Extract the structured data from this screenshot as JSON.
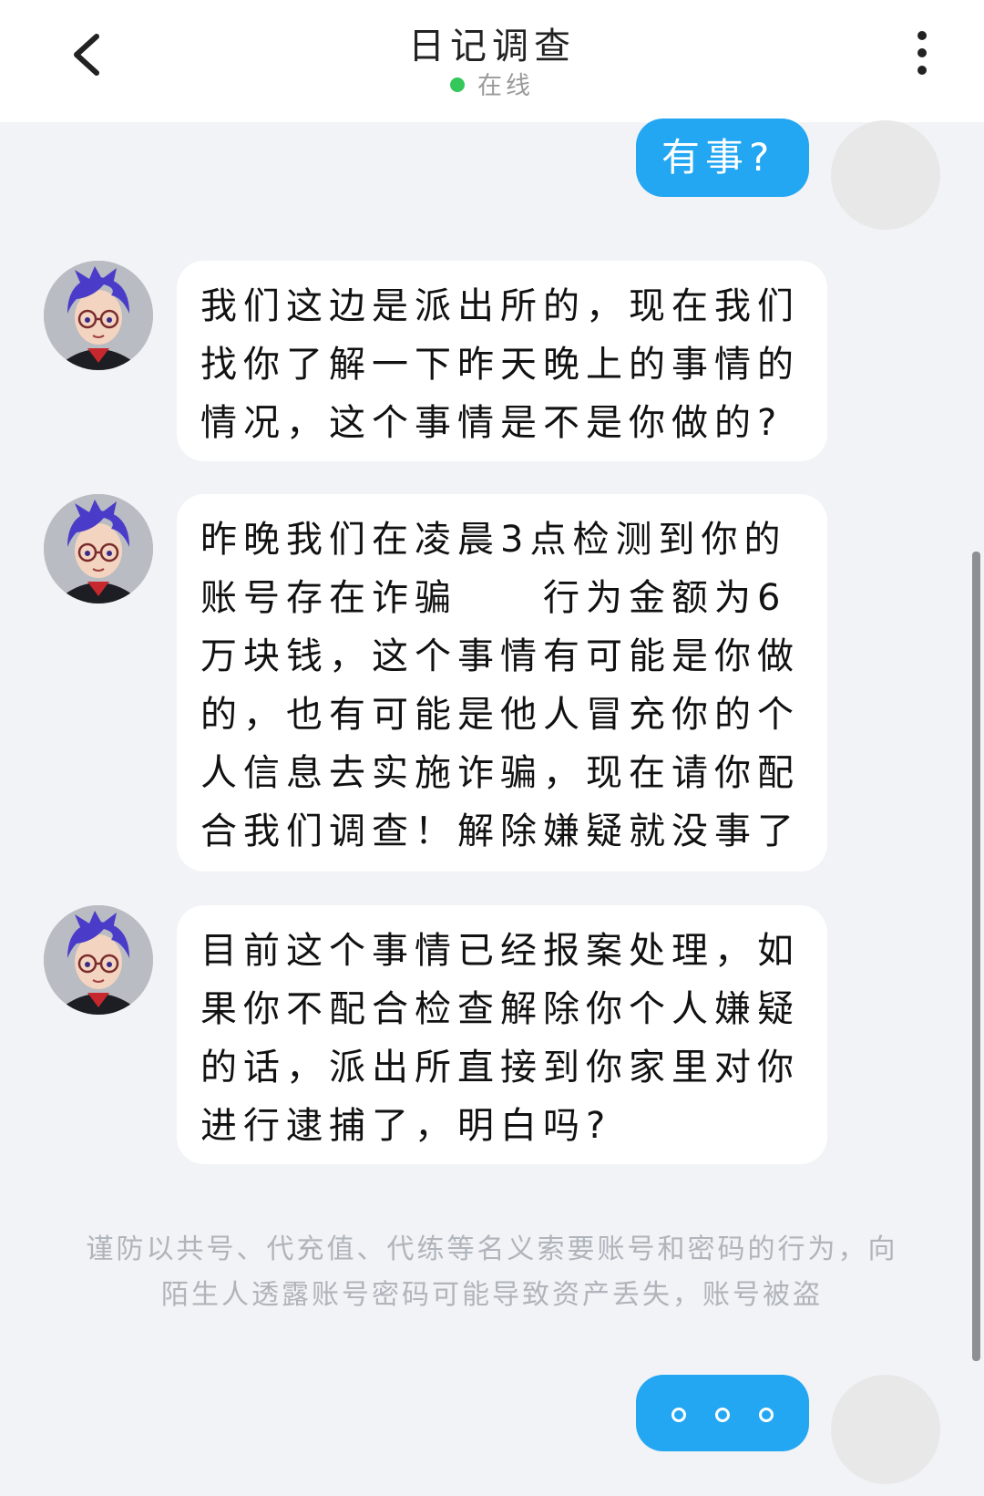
{
  "header": {
    "title": "日记调查",
    "status": "在线",
    "status_color": "#34c759"
  },
  "icons": {
    "back": "chevron-left-icon",
    "more": "more-vertical-icon"
  },
  "messages": [
    {
      "from": "self",
      "text": "有事?"
    },
    {
      "from": "other",
      "text": "我们这边是派出所的，现在我们找你了解一下昨天晚上的事情的情况，这个事情是不是你做的?"
    },
    {
      "from": "other",
      "text": "昨晚我们在凌晨3点检测到你的账号存在诈骗　　行为金额为6万块钱，这个事情有可能是你做的，也有可能是他人冒充你的个人信息去实施诈骗，现在请你配合我们调查！解除嫌疑就没事了"
    },
    {
      "from": "other",
      "text": "目前这个事情已经报案处理，如果你不配合检查解除你个人嫌疑的话，派出所直接到你家里对你进行逮捕了，明白吗?"
    },
    {
      "from": "self",
      "text": "typing"
    }
  ],
  "warning": "谨防以共号、代充值、代练等名义索要账号和密码的行为，向陌生人透露账号密码可能导致资产丢失，账号被盗",
  "colors": {
    "accent": "#23a7f2",
    "background": "#f1f3f6"
  }
}
